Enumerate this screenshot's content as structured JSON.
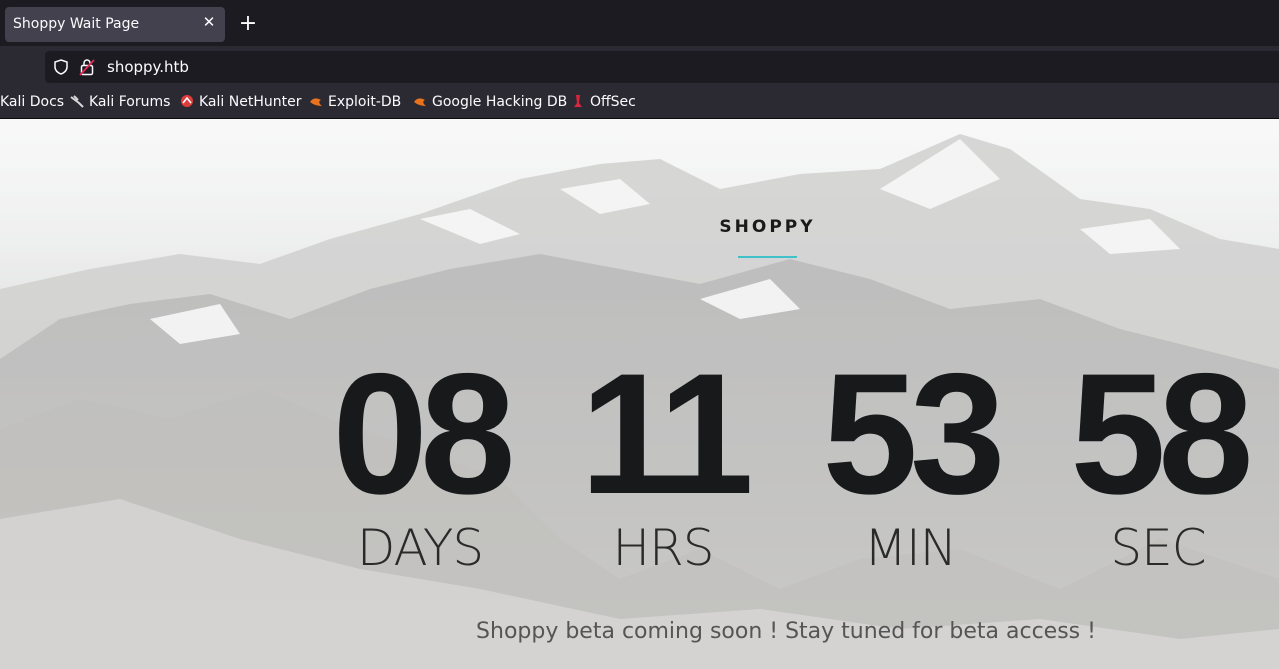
{
  "browser": {
    "tab_title": "Shoppy Wait Page",
    "url": "shoppy.htb",
    "bookmarks": [
      {
        "label": "Kali Docs",
        "icon": "kali-docs-icon"
      },
      {
        "label": "Kali Forums",
        "icon": "kali-dragon-icon"
      },
      {
        "label": "Kali NetHunter",
        "icon": "nethunter-icon"
      },
      {
        "label": "Exploit-DB",
        "icon": "exploitdb-icon"
      },
      {
        "label": "Google Hacking DB",
        "icon": "ghdb-icon"
      },
      {
        "label": "OffSec",
        "icon": "offsec-icon"
      }
    ]
  },
  "page": {
    "brand": "SHOPPY",
    "countdown": [
      {
        "value": "08",
        "label": "DAYS"
      },
      {
        "value": "11",
        "label": "HRS"
      },
      {
        "value": "53",
        "label": "MIN"
      },
      {
        "value": "58",
        "label": "SEC"
      }
    ],
    "tagline": "Shoppy beta coming soon ! Stay tuned for beta access !"
  },
  "colors": {
    "accent": "#3fc1c9",
    "digits": "#17191b",
    "chrome_dark": "#1c1b22",
    "chrome_mid": "#2b2a33"
  }
}
